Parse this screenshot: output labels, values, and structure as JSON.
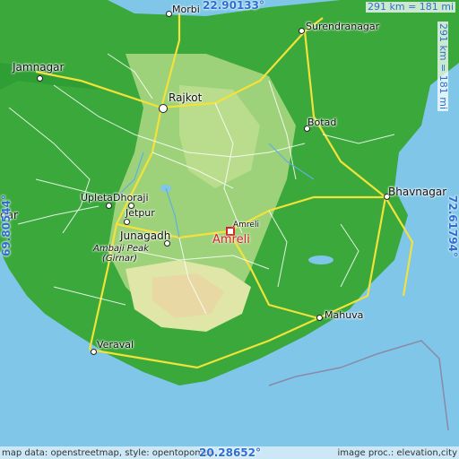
{
  "map": {
    "coords": {
      "top": "22.90133°",
      "bottom": "20.28652°",
      "left": "69.80544°",
      "right": "72.61794°"
    },
    "scale": {
      "horizontal": "291 km = 181 mi",
      "vertical": "291 km = 181 mi"
    },
    "footer": {
      "left": "map data: openstreetmap, style: opentopomap",
      "right": "image proc.: elevation,city"
    },
    "places": {
      "morbi": "Morbi",
      "surendranagar": "Surendranagar",
      "jamnagar": "Jamnagar",
      "rajkot": "Rajkot",
      "botad": "Botad",
      "upleta": "Upleta",
      "dhoraji": "Dhoraji",
      "jetpur": "Jetpur",
      "dar": "dar",
      "junagadh": "Junagadh",
      "amreli_small": "Amreli",
      "amreli_main": "Amreli",
      "bhavnagar": "Bhavnagar",
      "ambaji_peak": "Ambaji Peak",
      "girnar": "(Girnar)",
      "mahuva": "Mahuva",
      "veraval": "Veraval"
    },
    "colors": {
      "sea": "#7fc6e8",
      "lowland": "#3aa83a",
      "midland": "#9ed27a",
      "highland": "#dfe6a8",
      "road_major": "#f2e23a",
      "road_minor": "#ffffff",
      "highlight": "#d9232b",
      "coord_text": "#2b6fd6"
    }
  }
}
